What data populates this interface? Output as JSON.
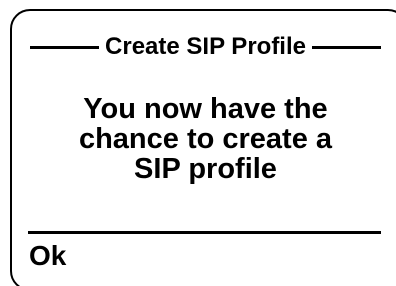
{
  "dialog": {
    "title": "Create SIP Profile",
    "message_lines": [
      "You now have the",
      "chance to create a",
      "SIP profile"
    ]
  },
  "softkeys": {
    "left_label": "Ok"
  },
  "colors": {
    "background": "#ffffff",
    "foreground": "#000000"
  }
}
